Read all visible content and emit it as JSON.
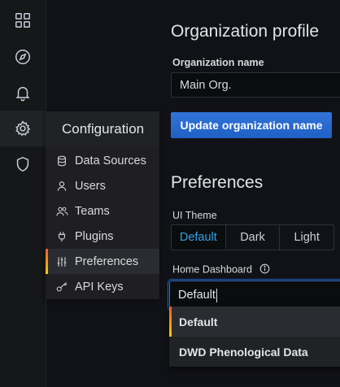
{
  "rail": {
    "items": [
      {
        "icon": "dashboards-grid-icon"
      },
      {
        "icon": "compass-icon"
      },
      {
        "icon": "bell-icon"
      },
      {
        "icon": "gear-icon"
      },
      {
        "icon": "shield-icon"
      }
    ]
  },
  "config_menu": {
    "title": "Configuration",
    "items": [
      {
        "label": "Data Sources",
        "icon": "database-icon"
      },
      {
        "label": "Users",
        "icon": "user-icon"
      },
      {
        "label": "Teams",
        "icon": "users-icon"
      },
      {
        "label": "Plugins",
        "icon": "plug-icon"
      },
      {
        "label": "Preferences",
        "icon": "sliders-icon"
      },
      {
        "label": "API Keys",
        "icon": "key-icon"
      }
    ]
  },
  "profile": {
    "title": "Organization profile",
    "name_label": "Organization name",
    "name_value": "Main Org.",
    "update_button": "Update organization name"
  },
  "preferences": {
    "title": "Preferences",
    "theme_label": "UI Theme",
    "themes": [
      "Default",
      "Dark",
      "Light"
    ],
    "selected_theme": "Default",
    "home_dashboard_label": "Home Dashboard",
    "home_dashboard_value": "Default",
    "options": [
      "Default",
      "DWD Phenological Data"
    ]
  },
  "colors": {
    "accent_blue": "#3274d9",
    "selected_text": "#33a2e5",
    "active_bar_top": "#f05a28",
    "active_bar_bottom": "#fbca0a"
  }
}
